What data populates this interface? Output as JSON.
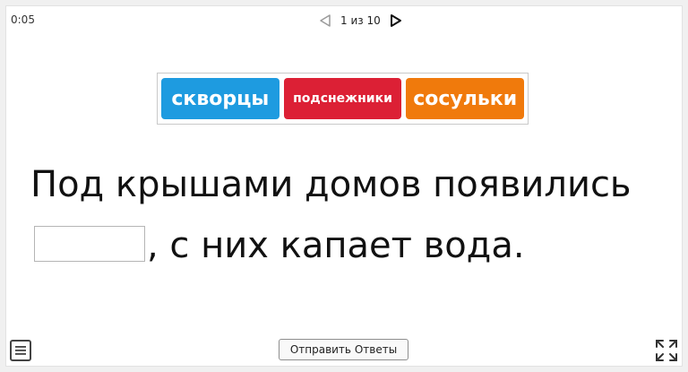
{
  "header": {
    "timer": "0:05",
    "pager": {
      "text": "1 из 10",
      "prev_icon": "triangle-left-outline",
      "next_icon": "triangle-right-outline"
    }
  },
  "word_bank": {
    "words": [
      {
        "label": "скворцы",
        "color": "#1e9be0"
      },
      {
        "label": "подснежники",
        "color": "#dc2035"
      },
      {
        "label": "сосульки",
        "color": "#f07a0c"
      }
    ]
  },
  "question": {
    "line1": "Под крышами домов появились",
    "after_blank": ", с них капает вода."
  },
  "footer": {
    "menu_icon": "menu-list-icon",
    "submit_label": "Отправить Ответы",
    "fullscreen_icon": "fullscreen-icon"
  }
}
